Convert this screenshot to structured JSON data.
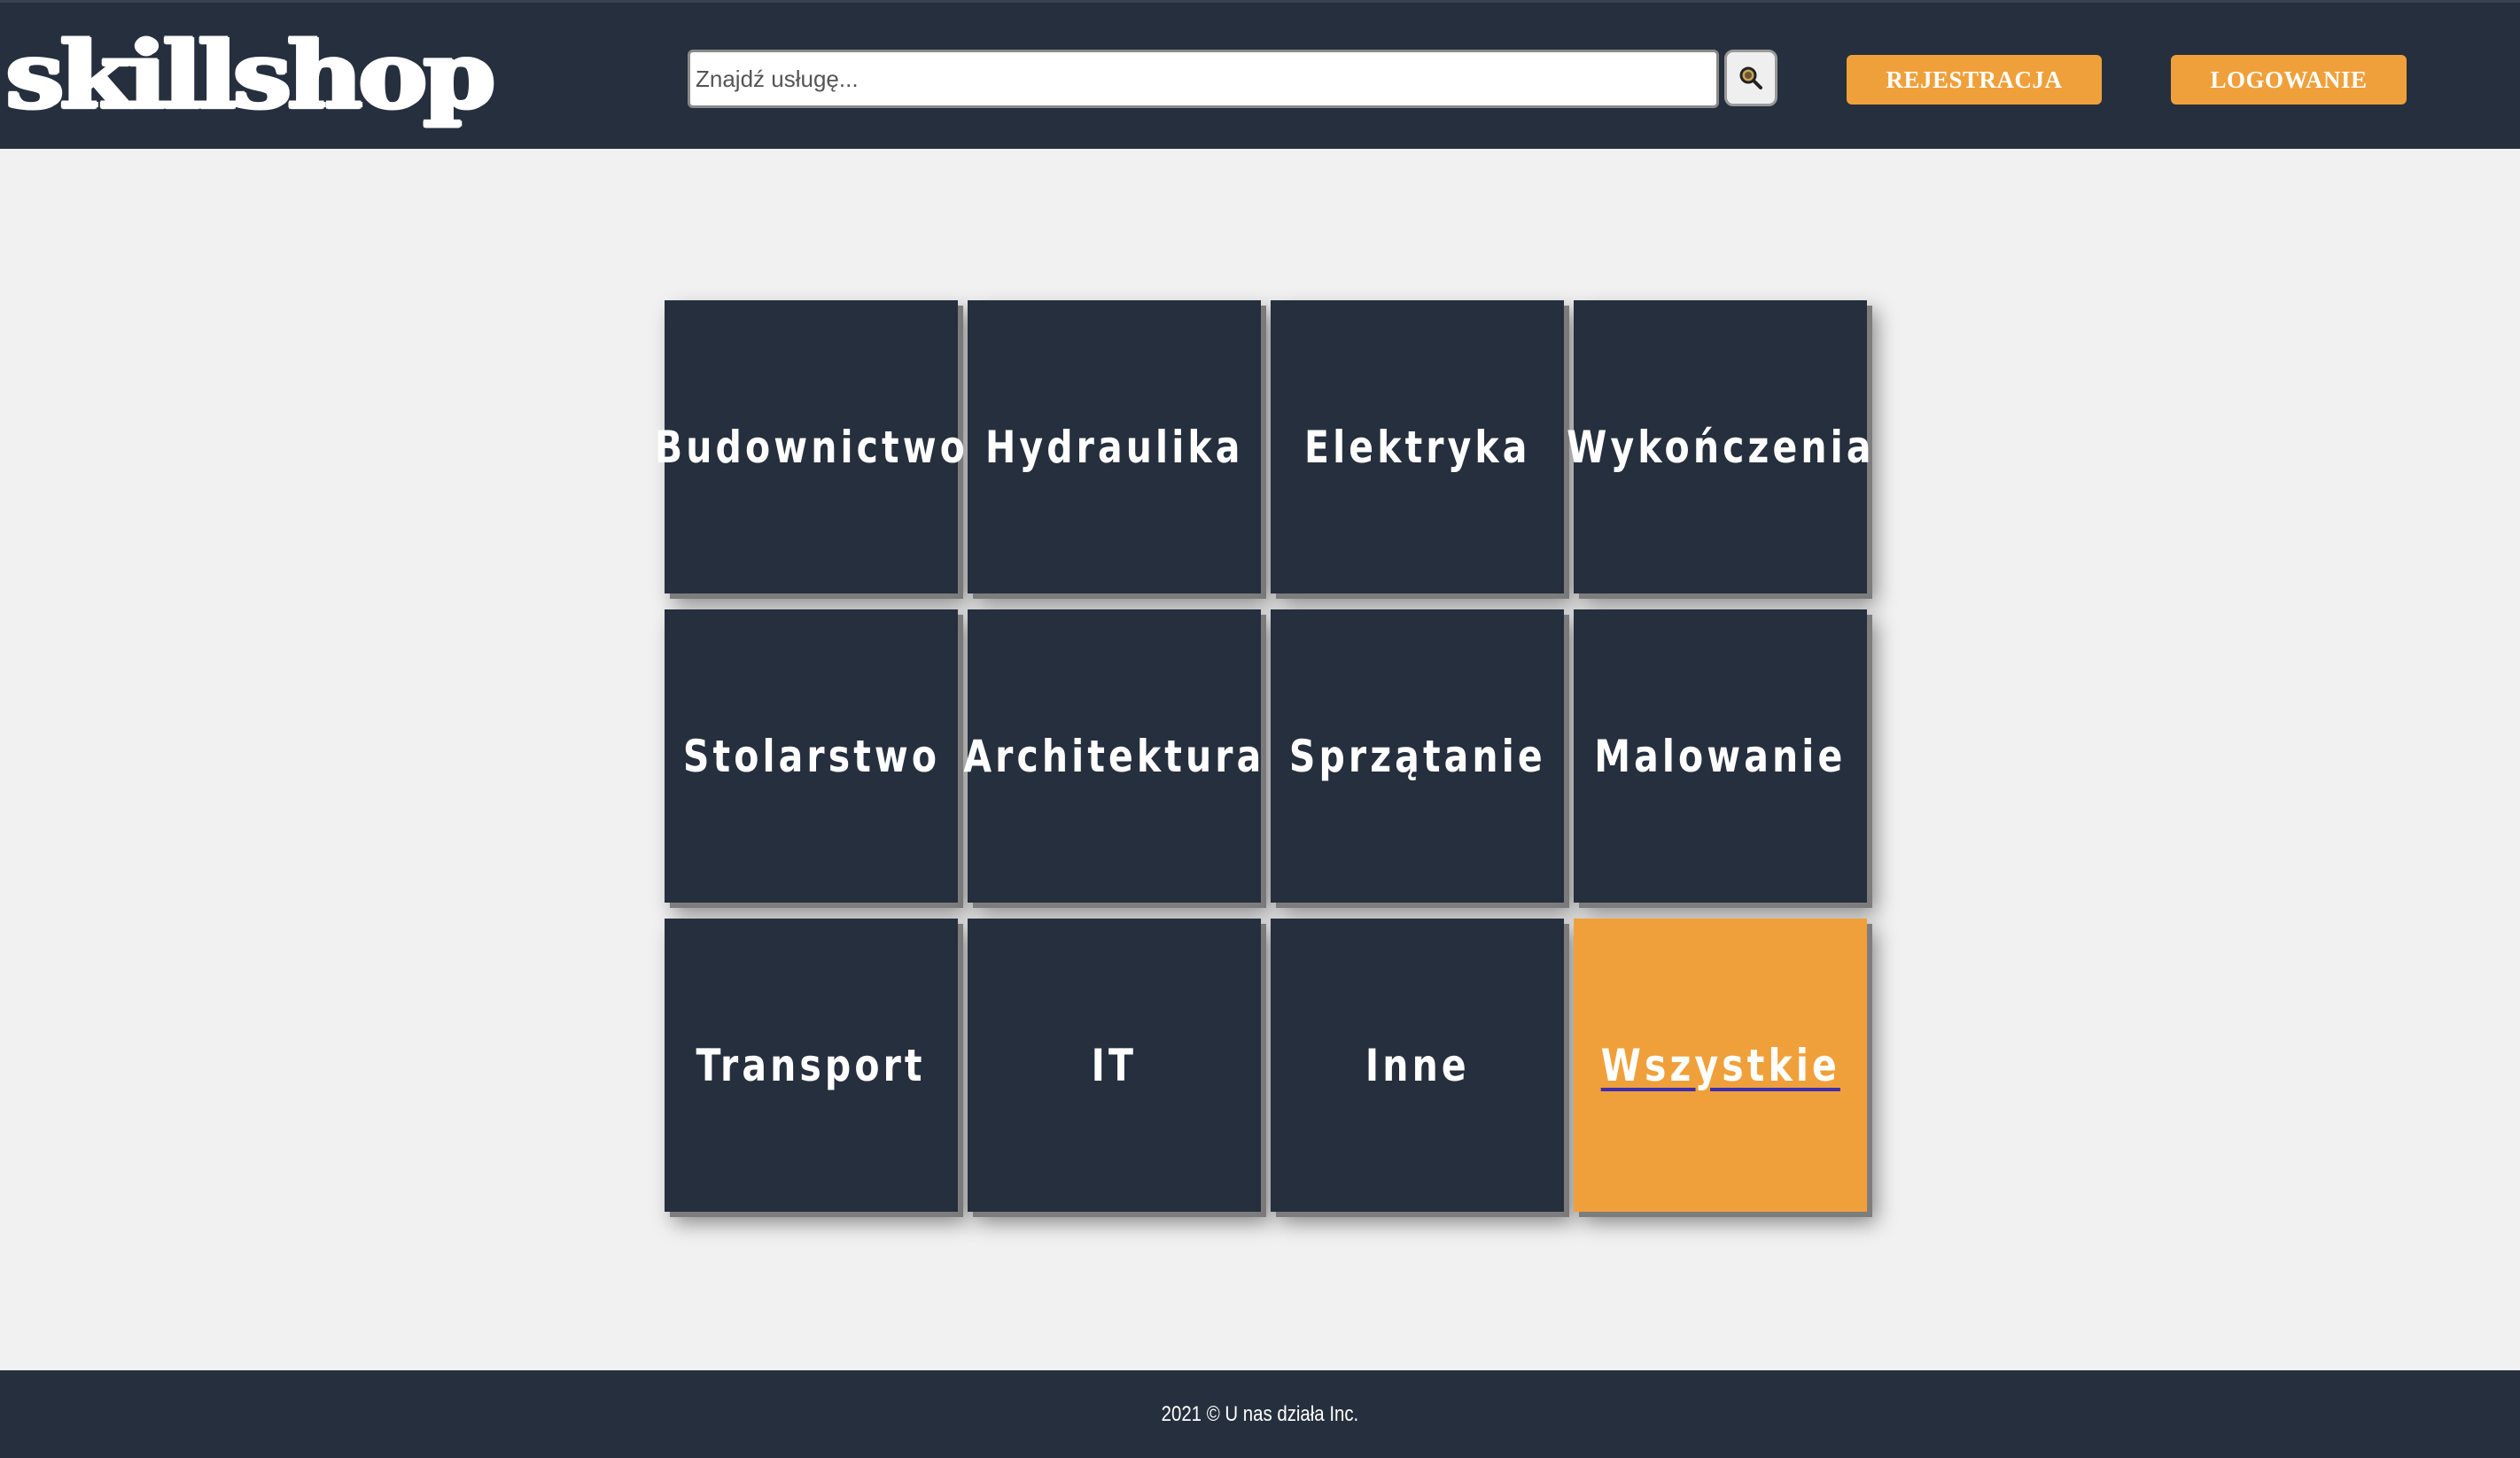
{
  "header": {
    "logo": "skillshop",
    "search_placeholder": "Znajdź usługę...",
    "search_icon": "search-icon",
    "register_label": "REJESTRACJA",
    "login_label": "LOGOWANIE"
  },
  "categories": [
    "Budownictwo",
    "Hydraulika",
    "Elektryka",
    "Wykończenia",
    "Stolarstwo",
    "Architektura",
    "Sprzątanie",
    "Malowanie",
    "Transport",
    "IT",
    "Inne",
    "Wszystkie"
  ],
  "active_category": "Wszystkie",
  "footer": {
    "copyright": "2021 © U nas działa Inc."
  },
  "colors": {
    "header_bg": "#262f3d",
    "page_bg": "#f1f1f1",
    "accent": "#f0a03a",
    "tile_bg": "#262f3d"
  }
}
